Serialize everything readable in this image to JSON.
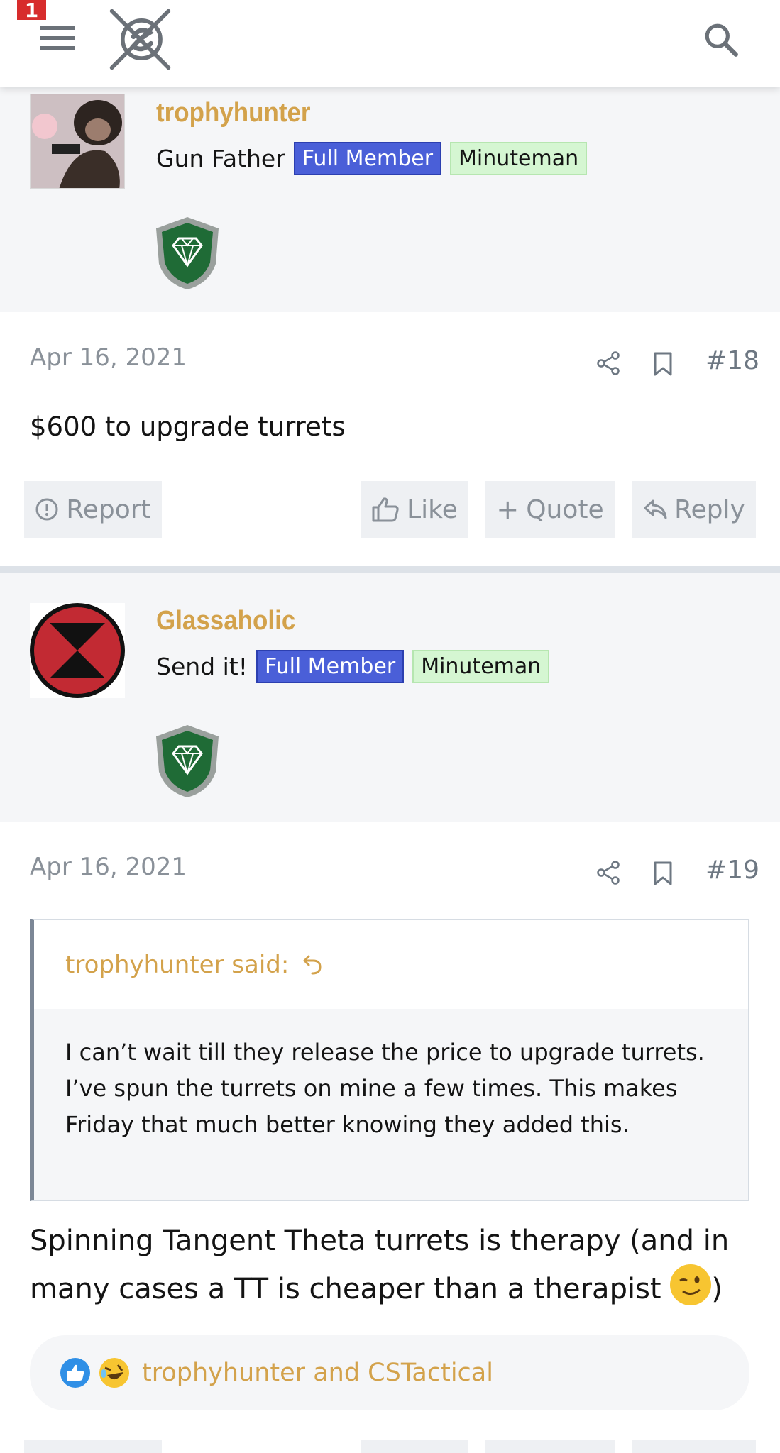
{
  "header": {
    "notification_count": "1",
    "icons": {
      "menu": "hamburger-menu-icon",
      "logo": "site-logo",
      "search": "search-icon"
    }
  },
  "posts": [
    {
      "user": {
        "name": "trophyhunter",
        "title": "Gun Father",
        "badges": [
          "Full Member",
          "Minuteman"
        ],
        "trophy_icon": "diamond-shield-icon"
      },
      "date": "Apr 16, 2021",
      "number": "#18",
      "body": "$600 to upgrade turrets",
      "actions": {
        "report": "Report",
        "like": "Like",
        "quote": "Quote",
        "reply": "Reply"
      }
    },
    {
      "user": {
        "name": "Glassaholic",
        "title": "Send it!",
        "badges": [
          "Full Member",
          "Minuteman"
        ],
        "trophy_icon": "diamond-shield-icon"
      },
      "date": "Apr 16, 2021",
      "number": "#19",
      "quote": {
        "author_line": "trophyhunter said:",
        "text": "I can’t wait till they release the price to upgrade turrets. I’ve spun the turrets on mine a few times. This makes Friday that much better knowing they added this."
      },
      "body": "Spinning Tangent Theta turrets is therapy (and in many cases a TT is cheaper than a therapist",
      "body_end": ")",
      "reactions": {
        "icons": [
          "like-reaction-icon",
          "laugh-reaction-icon"
        ],
        "names": "trophyhunter and CSTactical"
      }
    }
  ],
  "colors": {
    "username": "#d3a24b",
    "full_member_badge": "#4a5fd8",
    "minuteman_badge": "#d5f6d2",
    "notification": "#d72c2c",
    "muted_text": "#8a9199",
    "panel_bg": "#f5f6f8"
  }
}
